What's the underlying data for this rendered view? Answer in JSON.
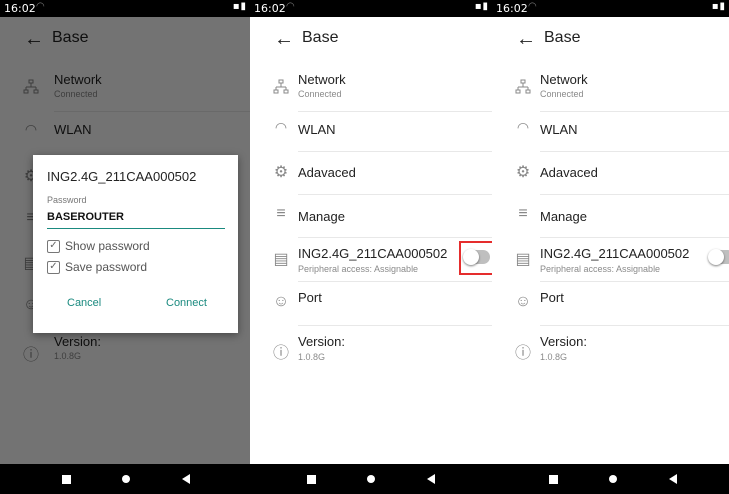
{
  "status": {
    "time": "16:02"
  },
  "app": {
    "title": "Base"
  },
  "menu": {
    "network_label": "Network",
    "network_status": "Connected",
    "wlan_label": "WLAN",
    "advanced_label": "Adavaced",
    "manage_label": "Manage",
    "peripheral_label": "ING2.4G_211CAA000502",
    "peripheral_sub": "Peripheral access: Assignable",
    "port_label": "Port",
    "version_label": "Version:",
    "version_value": "1.0.8G"
  },
  "dialog": {
    "title": "ING2.4G_211CAA000502",
    "password_label": "Password",
    "password_value": "BASEROUTER",
    "show_password": "Show password",
    "save_password": "Save password",
    "cancel": "Cancel",
    "connect": "Connect"
  },
  "toggle": {
    "peripheral_enabled": false
  },
  "colors": {
    "accent": "#1a8a7f",
    "highlight_box": "#e52d2d",
    "toggle_off": "#bfbfbf"
  }
}
